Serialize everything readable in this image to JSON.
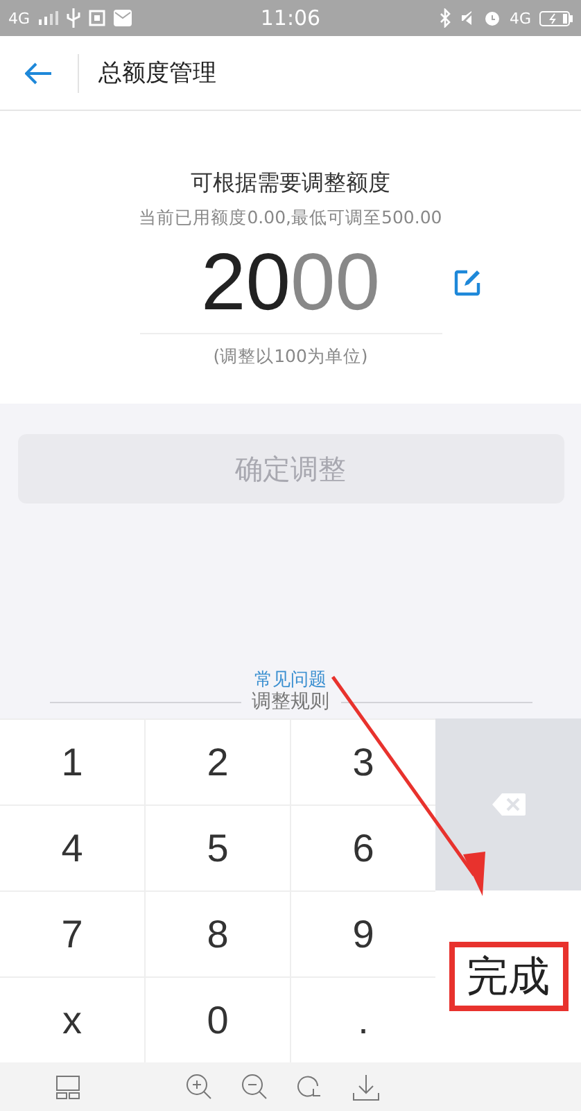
{
  "status_bar": {
    "left": "4G",
    "time": "11:06",
    "right": "4G"
  },
  "header": {
    "title": "总额度管理"
  },
  "intro": {
    "heading": "可根据需要调整额度",
    "note": "当前已用额度0.00,最低可调至500.00"
  },
  "amount": {
    "typed": "20",
    "hint": "00",
    "unit_note": "(调整以100为单位)"
  },
  "confirm_button": {
    "label": "确定调整",
    "disabled": true
  },
  "faq_link": "常见问题",
  "rules_label": "调整规则",
  "keypad": {
    "keys": [
      {
        "label": "1"
      },
      {
        "label": "2"
      },
      {
        "label": "3"
      },
      {
        "label": "4"
      },
      {
        "label": "5"
      },
      {
        "label": "6"
      },
      {
        "label": "7"
      },
      {
        "label": "8"
      },
      {
        "label": "9"
      },
      {
        "label": "x"
      },
      {
        "label": "0"
      },
      {
        "label": "."
      }
    ],
    "done": "完成"
  },
  "annotation": {
    "highlight_done": true
  }
}
